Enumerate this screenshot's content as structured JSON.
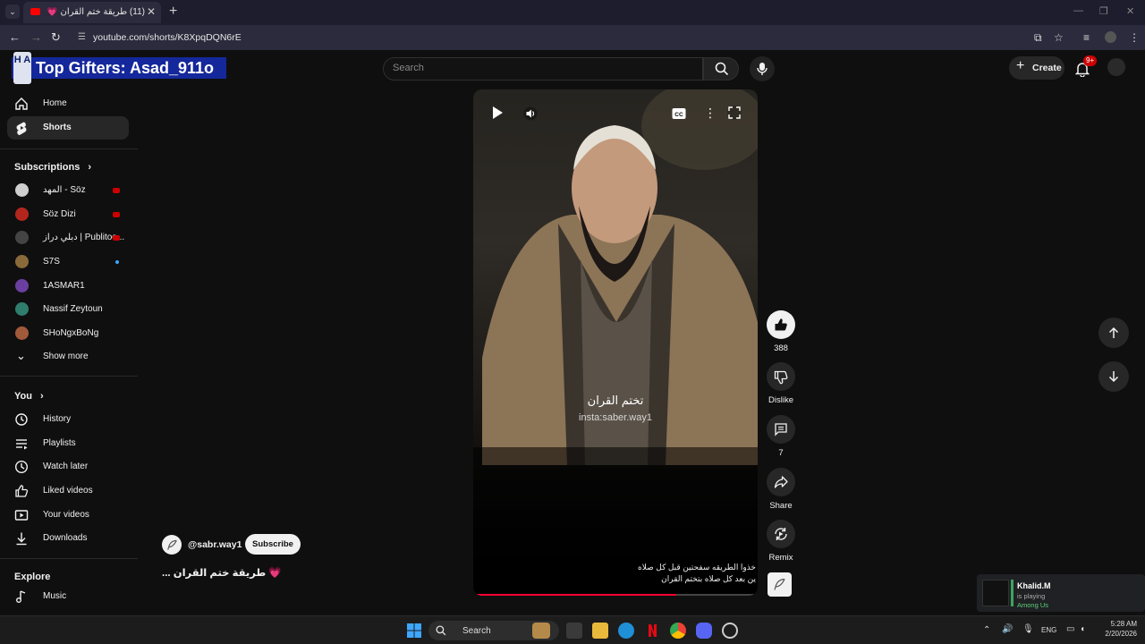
{
  "browser": {
    "tab_title": "(11) طريقة ختم القران 💗 #حالات...",
    "url": "youtube.com/shorts/K8XpqDQN6rE"
  },
  "overlay": {
    "gift_logo_text": "H A",
    "gift_banner": "Top Gifters: Asad_911o"
  },
  "header": {
    "search_placeholder": "Search",
    "create_label": "Create",
    "notif_badge": "9+"
  },
  "sidebar": {
    "top": [
      {
        "label": "Home",
        "icon": "home-icon"
      },
      {
        "label": "Shorts",
        "icon": "shorts-icon",
        "active": true
      }
    ],
    "subscriptions_title": "Subscriptions",
    "subscriptions": [
      {
        "label": "المهد - Söz",
        "color": "#cfcfcf",
        "status": "live"
      },
      {
        "label": "Söz Dizi",
        "color": "#b3261e",
        "status": "live"
      },
      {
        "label": "دبلي دراز | Publitoo...",
        "color": "#444444",
        "status": "live"
      },
      {
        "label": "S7S",
        "color": "#8a6a3a",
        "status": "new"
      },
      {
        "label": "1ASMAR1",
        "color": "#6b3fa0",
        "status": "none"
      },
      {
        "label": "Nassif Zeytoun",
        "color": "#2f7d6d",
        "status": "none"
      },
      {
        "label": "SHoNgxBoNg",
        "color": "#a05a3a",
        "status": "none"
      }
    ],
    "show_more": "Show more",
    "you_title": "You",
    "you_items": [
      {
        "label": "History",
        "icon": "history-icon"
      },
      {
        "label": "Playlists",
        "icon": "playlists-icon"
      },
      {
        "label": "Watch later",
        "icon": "watch-later-icon"
      },
      {
        "label": "Liked videos",
        "icon": "liked-videos-icon"
      },
      {
        "label": "Your videos",
        "icon": "your-videos-icon"
      },
      {
        "label": "Downloads",
        "icon": "downloads-icon"
      }
    ],
    "explore_title": "Explore",
    "explore_items": [
      {
        "label": "Music",
        "icon": "music-icon"
      }
    ]
  },
  "short": {
    "caption_main": "تختم القران",
    "caption_insta": "insta:saber.way1",
    "subtitle_line1": "خذوا الطريقه سفحتين قبل كل صلاه",
    "subtitle_line2": "ين بعد كل صلاه بتختم القران",
    "progress": 0.72,
    "channel_handle": "@sabr.way1",
    "subscribe_label": "Subscribe",
    "title": "💗 طريقة ختم القران ..."
  },
  "actions": {
    "like_count": "388",
    "dislike_label": "Dislike",
    "comment_count": "7",
    "share_label": "Share",
    "remix_label": "Remix"
  },
  "toast": {
    "name": "Khalid.M",
    "status": "is playing",
    "game": "Among Us"
  },
  "taskbar": {
    "search_label": "Search",
    "lang": "ENG",
    "time": "5:28 AM",
    "date": "2/20/2026"
  }
}
